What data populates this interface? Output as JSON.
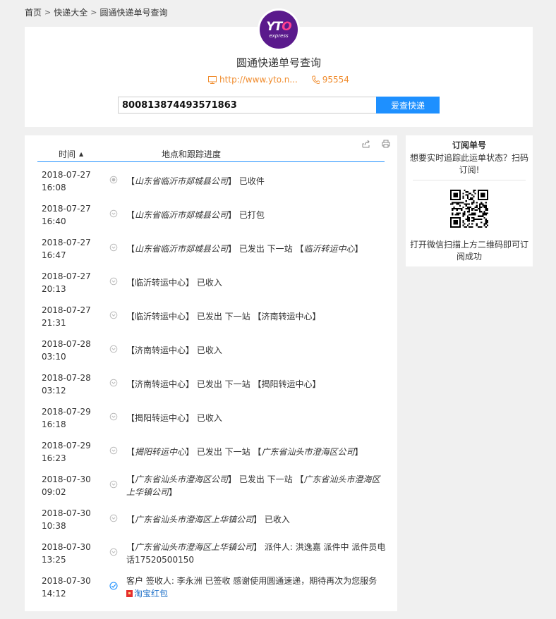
{
  "breadcrumb": {
    "home": "首页",
    "category": "快递大全",
    "current": "圆通快递单号查询"
  },
  "header": {
    "logo_main": "YTO",
    "logo_sub": "express",
    "title": "圆通快递单号查询",
    "website": "http://www.yto.n...",
    "phone": "95554",
    "search_value": "800813874493571863",
    "search_button": "爱查快递"
  },
  "tracking": {
    "col_time": "时间",
    "col_location": "地点和跟踪进度",
    "rows": [
      {
        "date": "2018-07-27",
        "time": "16:08",
        "parts": [
          {
            "t": "【"
          },
          {
            "i": "山东省临沂市郯城县公司"
          },
          {
            "t": "】 已收件"
          }
        ]
      },
      {
        "date": "2018-07-27",
        "time": "16:40",
        "parts": [
          {
            "t": "【"
          },
          {
            "i": "山东省临沂市郯城县公司"
          },
          {
            "t": "】 已打包"
          }
        ]
      },
      {
        "date": "2018-07-27",
        "time": "16:47",
        "parts": [
          {
            "t": "【"
          },
          {
            "i": "山东省临沂市郯城县公司"
          },
          {
            "t": "】 已发出 下一站 【"
          },
          {
            "i": "临沂转运中心"
          },
          {
            "t": "】"
          }
        ]
      },
      {
        "date": "2018-07-27",
        "time": "20:13",
        "parts": [
          {
            "t": "【临沂转运中心】 已收入"
          }
        ]
      },
      {
        "date": "2018-07-27",
        "time": "21:31",
        "parts": [
          {
            "t": "【临沂转运中心】 已发出 下一站 【济南转运中心】"
          }
        ]
      },
      {
        "date": "2018-07-28",
        "time": "03:10",
        "parts": [
          {
            "t": "【济南转运中心】 已收入"
          }
        ]
      },
      {
        "date": "2018-07-28",
        "time": "03:12",
        "parts": [
          {
            "t": "【济南转运中心】 已发出 下一站 【揭阳转运中心】"
          }
        ]
      },
      {
        "date": "2018-07-29",
        "time": "16:18",
        "parts": [
          {
            "t": "【揭阳转运中心】 已收入"
          }
        ]
      },
      {
        "date": "2018-07-29",
        "time": "16:23",
        "parts": [
          {
            "t": "【"
          },
          {
            "i": "揭阳转运中心"
          },
          {
            "t": "】 已发出 下一站 【"
          },
          {
            "i": "广东省汕头市澄海区公司"
          },
          {
            "t": "】"
          }
        ]
      },
      {
        "date": "2018-07-30",
        "time": "09:02",
        "parts": [
          {
            "t": "【"
          },
          {
            "i": "广东省汕头市澄海区公司"
          },
          {
            "t": "】 已发出 下一站 【"
          },
          {
            "i": "广东省汕头市澄海区上华镇公司"
          },
          {
            "t": "】"
          }
        ]
      },
      {
        "date": "2018-07-30",
        "time": "10:38",
        "parts": [
          {
            "t": "【"
          },
          {
            "i": "广东省汕头市澄海区上华镇公司"
          },
          {
            "t": "】 已收入"
          }
        ]
      },
      {
        "date": "2018-07-30",
        "time": "13:25",
        "parts": [
          {
            "t": "【"
          },
          {
            "i": "广东省汕头市澄海区上华镇公司"
          },
          {
            "t": "】 派件人: 洪逸嘉 派件中 派件员电话17520500150"
          }
        ]
      },
      {
        "date": "2018-07-30",
        "time": "14:12",
        "parts": [
          {
            "t": "客户 签收人: 李永洲 已签收 感谢使用圆通速递，期待再次为您服务"
          }
        ],
        "link": "淘宝红包"
      }
    ]
  },
  "subscribe": {
    "title": "订阅单号",
    "desc": "想要实时追踪此运单状态？扫码订阅!",
    "foot": "打开微信扫描上方二维码即可订阅成功"
  },
  "colors": {
    "accent": "#1e90ff",
    "orange": "#f08c2e",
    "logo_bg": "#5a1a8c",
    "logo_x": "#ff3f8e"
  }
}
